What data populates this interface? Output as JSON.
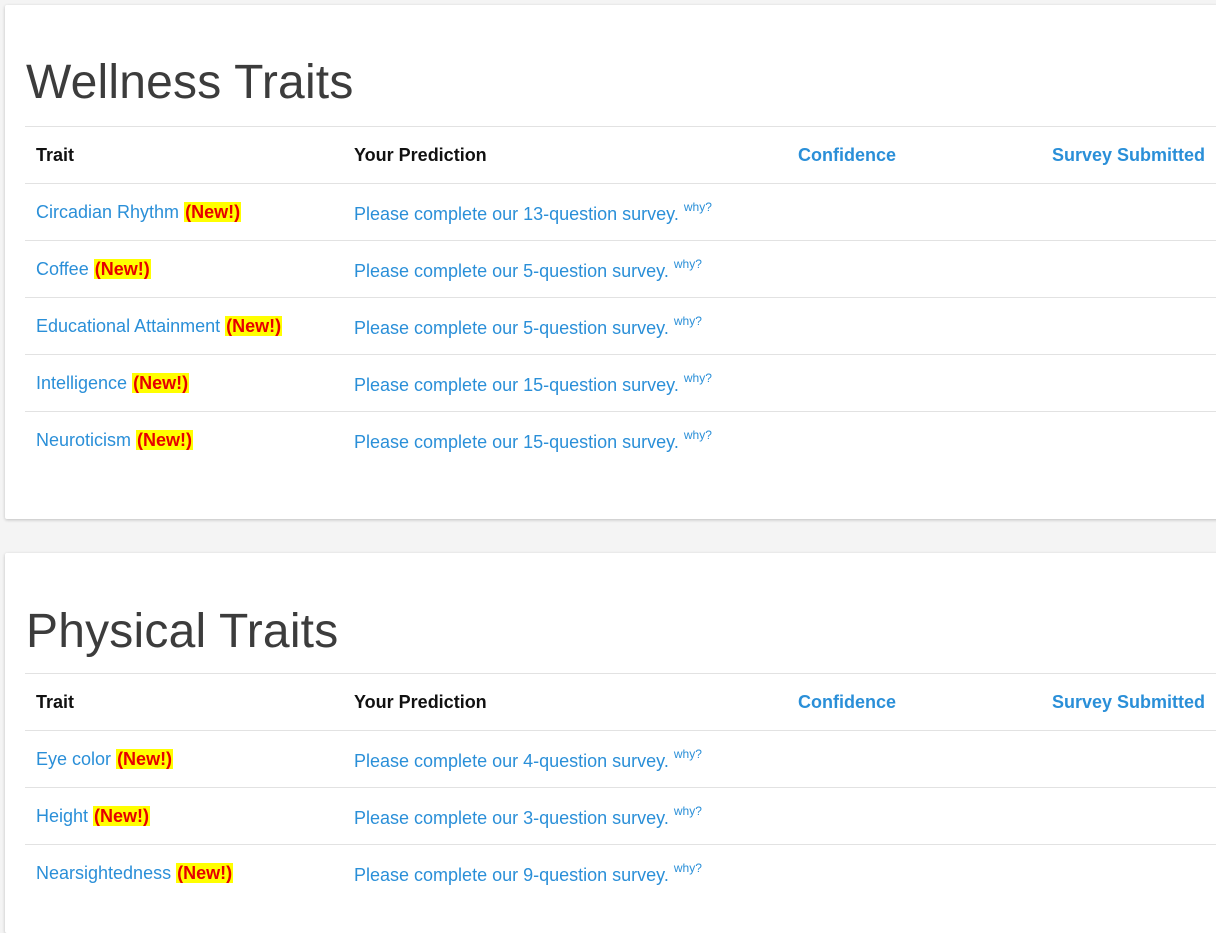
{
  "wellness": {
    "title": "Wellness Traits",
    "headers": {
      "trait": "Trait",
      "prediction": "Your Prediction",
      "confidence": "Confidence",
      "survey_submitted": "Survey Submitted"
    },
    "rows": [
      {
        "trait": "Circadian Rhythm",
        "badge": "(New!)",
        "prediction": "Please complete our 13-question survey.",
        "why": "why?"
      },
      {
        "trait": "Coffee",
        "badge": "(New!)",
        "prediction": "Please complete our 5-question survey.",
        "why": "why?"
      },
      {
        "trait": "Educational Attainment",
        "badge": "(New!)",
        "prediction": "Please complete our 5-question survey.",
        "why": "why?"
      },
      {
        "trait": "Intelligence",
        "badge": "(New!)",
        "prediction": "Please complete our 15-question survey.",
        "why": "why?"
      },
      {
        "trait": "Neuroticism",
        "badge": "(New!)",
        "prediction": "Please complete our 15-question survey.",
        "why": "why?"
      }
    ]
  },
  "physical": {
    "title": "Physical Traits",
    "headers": {
      "trait": "Trait",
      "prediction": "Your Prediction",
      "confidence": "Confidence",
      "survey_submitted": "Survey Submitted"
    },
    "rows": [
      {
        "trait": "Eye color",
        "badge": "(New!)",
        "prediction": "Please complete our 4-question survey.",
        "why": "why?"
      },
      {
        "trait": "Height",
        "badge": "(New!)",
        "prediction": "Please complete our 3-question survey.",
        "why": "why?"
      },
      {
        "trait": "Nearsightedness",
        "badge": "(New!)",
        "prediction": "Please complete our 9-question survey.",
        "why": "why?"
      }
    ]
  },
  "colors": {
    "link": "#2a8fd8",
    "badge_background": "#ffff00",
    "badge_text": "#e60000",
    "page_background": "#f4f4f4"
  }
}
